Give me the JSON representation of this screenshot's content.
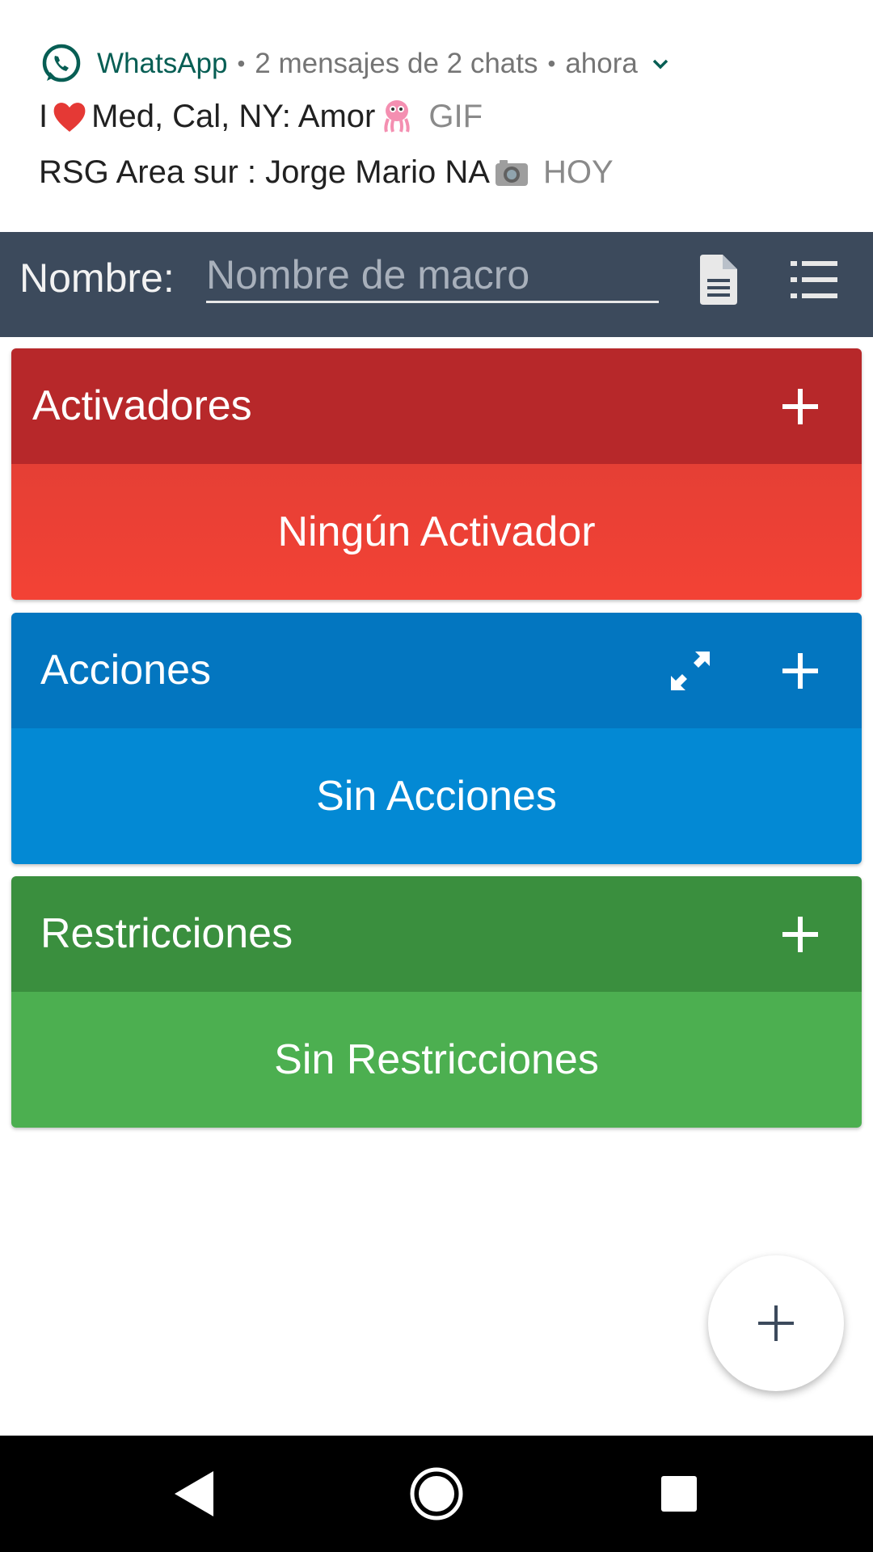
{
  "notification": {
    "app_name": "WhatsApp",
    "summary": "2 mensajes de 2 chats",
    "time": "ahora",
    "messages": [
      {
        "prefix": "I ",
        "emoji_before": "heart-emoji",
        "text": "Med, Cal, NY: Amor ",
        "emoji_after": "octopus-emoji",
        "suffix": "GIF"
      },
      {
        "text": "RSG Area sur : Jorge Mario NA ",
        "emoji_after": "camera-emoji",
        "suffix": "HOY"
      }
    ]
  },
  "toolbar": {
    "name_label": "Nombre:",
    "name_placeholder": "Nombre de macro",
    "name_value": "",
    "icons": [
      "document-icon",
      "list-icon"
    ]
  },
  "panels": {
    "triggers": {
      "title": "Activadores",
      "empty_text": "Ningún Activador",
      "color": "#b7282a"
    },
    "actions": {
      "title": "Acciones",
      "empty_text": "Sin Acciones",
      "color": "#0376c0"
    },
    "constraints": {
      "title": "Restricciones",
      "empty_text": "Sin Restricciones",
      "color": "#3a8f3e"
    }
  },
  "fab": {
    "icon": "plus-icon"
  },
  "navbar": {
    "icons": [
      "back-icon",
      "home-icon",
      "recents-icon"
    ]
  }
}
